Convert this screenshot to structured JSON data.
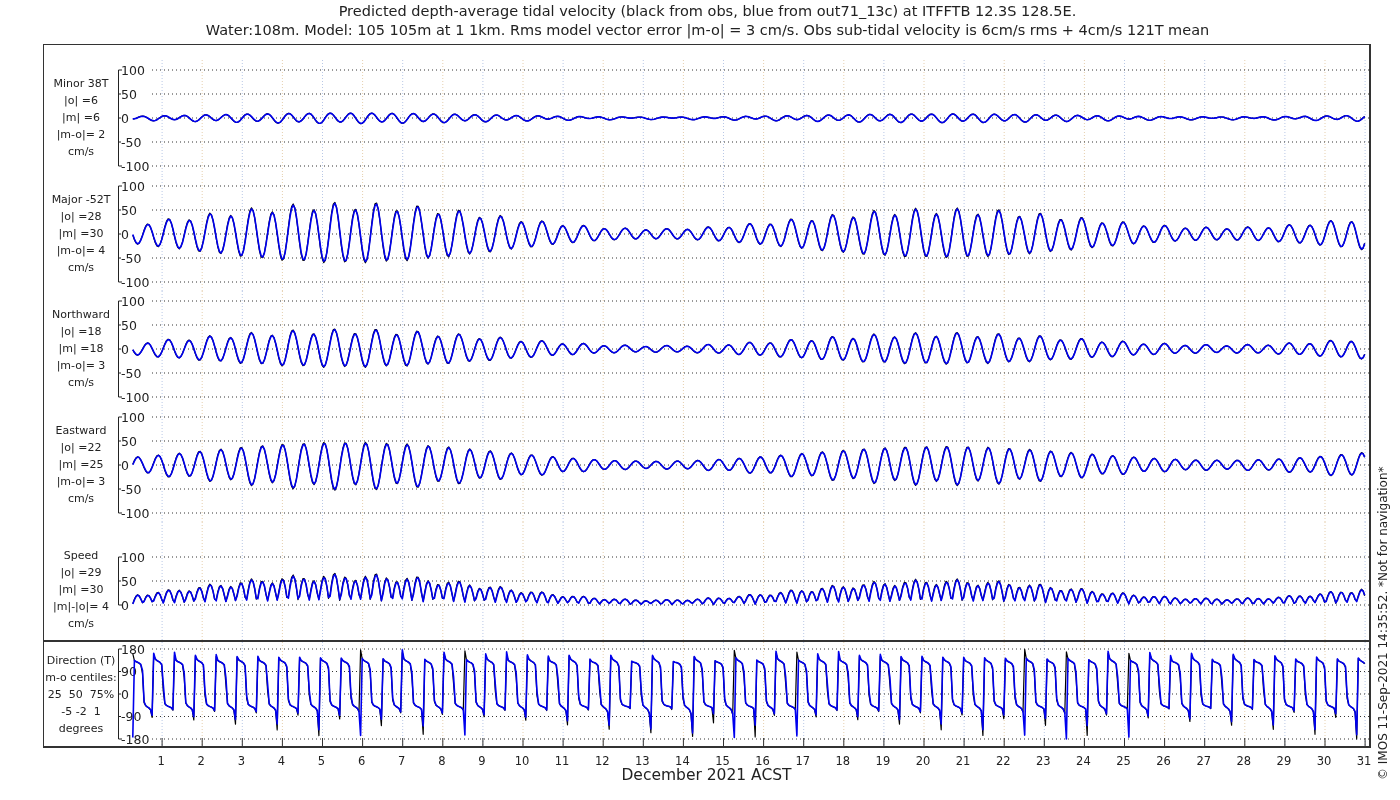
{
  "title_lines": [
    "Predicted depth-average tidal velocity (black from obs, blue from out71_13c) at ITFFTB 12.3S 128.5E.",
    "Water:108m. Model: 105 105m at 1 1km. Rms model vector error |m-o| = 3 cm/s. Obs sub-tidal velocity is 6cm/s rms + 4cm/s 121T mean"
  ],
  "panels": [
    {
      "kind": "minor",
      "label_lines": [
        "Minor 38T",
        "|o| =6",
        "|m| =6",
        "|m-o|= 2",
        "cm/s"
      ],
      "y_tick_labels": [
        "100",
        "50",
        "0",
        "-50",
        "-100"
      ]
    },
    {
      "kind": "major",
      "label_lines": [
        "Major -52T",
        "|o| =28",
        "|m| =30",
        "|m-o|= 4",
        "cm/s"
      ],
      "y_tick_labels": [
        "100",
        "50",
        "0",
        "-50",
        "-100"
      ]
    },
    {
      "kind": "north",
      "label_lines": [
        "Northward",
        "|o| =18",
        "|m| =18",
        "|m-o|= 3",
        "cm/s"
      ],
      "y_tick_labels": [
        "100",
        "50",
        "0",
        "-50",
        "-100"
      ]
    },
    {
      "kind": "east",
      "label_lines": [
        "Eastward",
        "|o| =22",
        "|m| =25",
        "|m-o|= 3",
        "cm/s"
      ],
      "y_tick_labels": [
        "100",
        "50",
        "0",
        "-50",
        "-100"
      ]
    },
    {
      "kind": "speed",
      "label_lines": [
        "Speed",
        "|o| =29",
        "|m| =30",
        "|m|-|o|= 4",
        "cm/s"
      ],
      "y_tick_labels": [
        "100",
        "50",
        "0"
      ]
    },
    {
      "kind": "direction",
      "label_lines": [
        "Direction (T)",
        "m-o centiles:",
        "25  50  75%",
        "-5 -2  1",
        "degrees"
      ],
      "y_tick_labels": [
        "180",
        "90",
        "0",
        "-90",
        "-180"
      ]
    }
  ],
  "x_tick_labels": [
    "1",
    "2",
    "3",
    "4",
    "5",
    "6",
    "7",
    "8",
    "9",
    "10",
    "11",
    "12",
    "13",
    "14",
    "15",
    "16",
    "17",
    "18",
    "19",
    "20",
    "21",
    "22",
    "23",
    "24",
    "25",
    "26",
    "27",
    "28",
    "29",
    "30",
    "31"
  ],
  "xlabel": "December 2021 ACST",
  "credit": "© IMOS 11-Sep-2021 14:35:52. *Not for navigation*"
}
